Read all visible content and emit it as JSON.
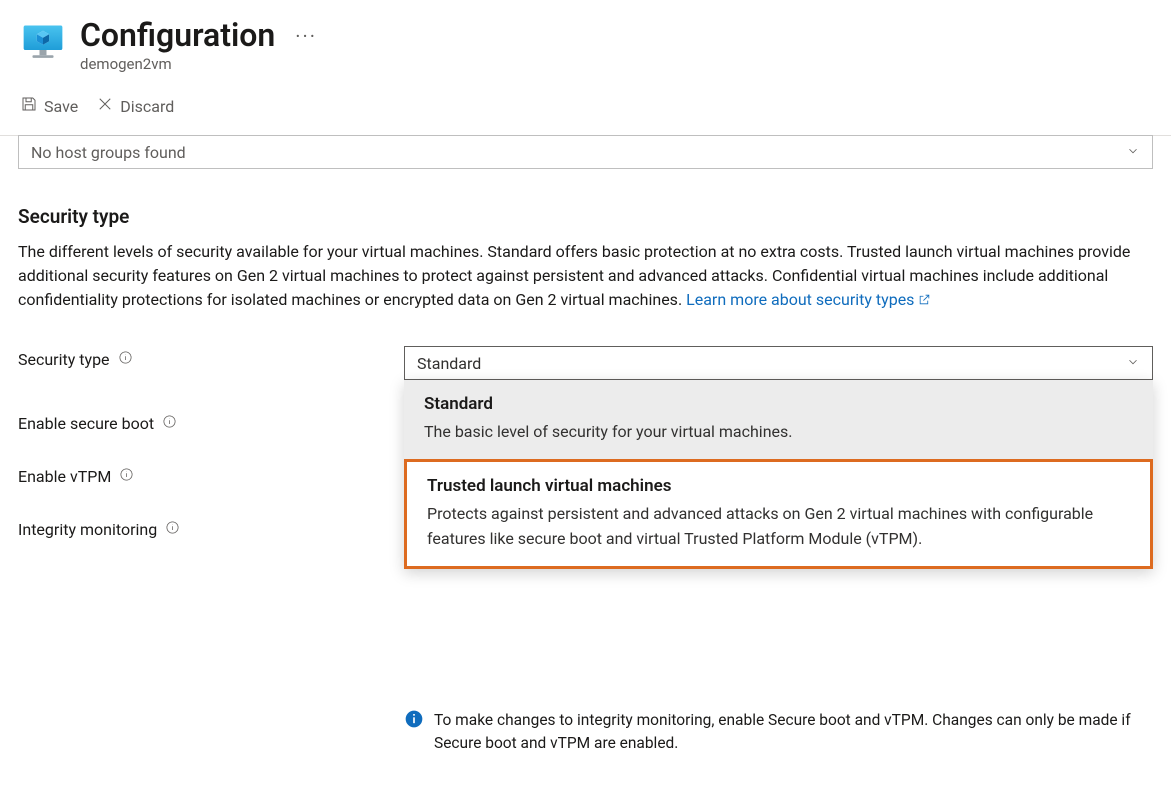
{
  "header": {
    "title": "Configuration",
    "subtitle": "demogen2vm"
  },
  "toolbar": {
    "save_label": "Save",
    "discard_label": "Discard"
  },
  "host_group_dropdown": {
    "placeholder": "No host groups found"
  },
  "section": {
    "title": "Security type",
    "description": "The different levels of security available for your virtual machines. Standard offers basic protection at no extra costs. Trusted launch virtual machines provide additional security features on Gen 2 virtual machines to protect against persistent and advanced attacks. Confidential virtual machines include additional confidentiality protections for isolated machines or encrypted data on Gen 2 virtual machines.",
    "learn_more_text": "Learn more about security types"
  },
  "fields": {
    "security_type_label": "Security type",
    "enable_secure_boot_label": "Enable secure boot",
    "enable_vtpm_label": "Enable vTPM",
    "integrity_monitoring_label": "Integrity monitoring"
  },
  "security_type_select": {
    "selected": "Standard",
    "options": [
      {
        "title": "Standard",
        "description": "The basic level of security for your virtual machines."
      },
      {
        "title": "Trusted launch virtual machines",
        "description": "Protects against persistent and advanced attacks on Gen 2 virtual machines with configurable features like secure boot and virtual Trusted Platform Module (vTPM)."
      }
    ]
  },
  "callout": {
    "text": "To make changes to integrity monitoring, enable Secure boot and vTPM. Changes can only be made if Secure boot and vTPM are enabled."
  }
}
